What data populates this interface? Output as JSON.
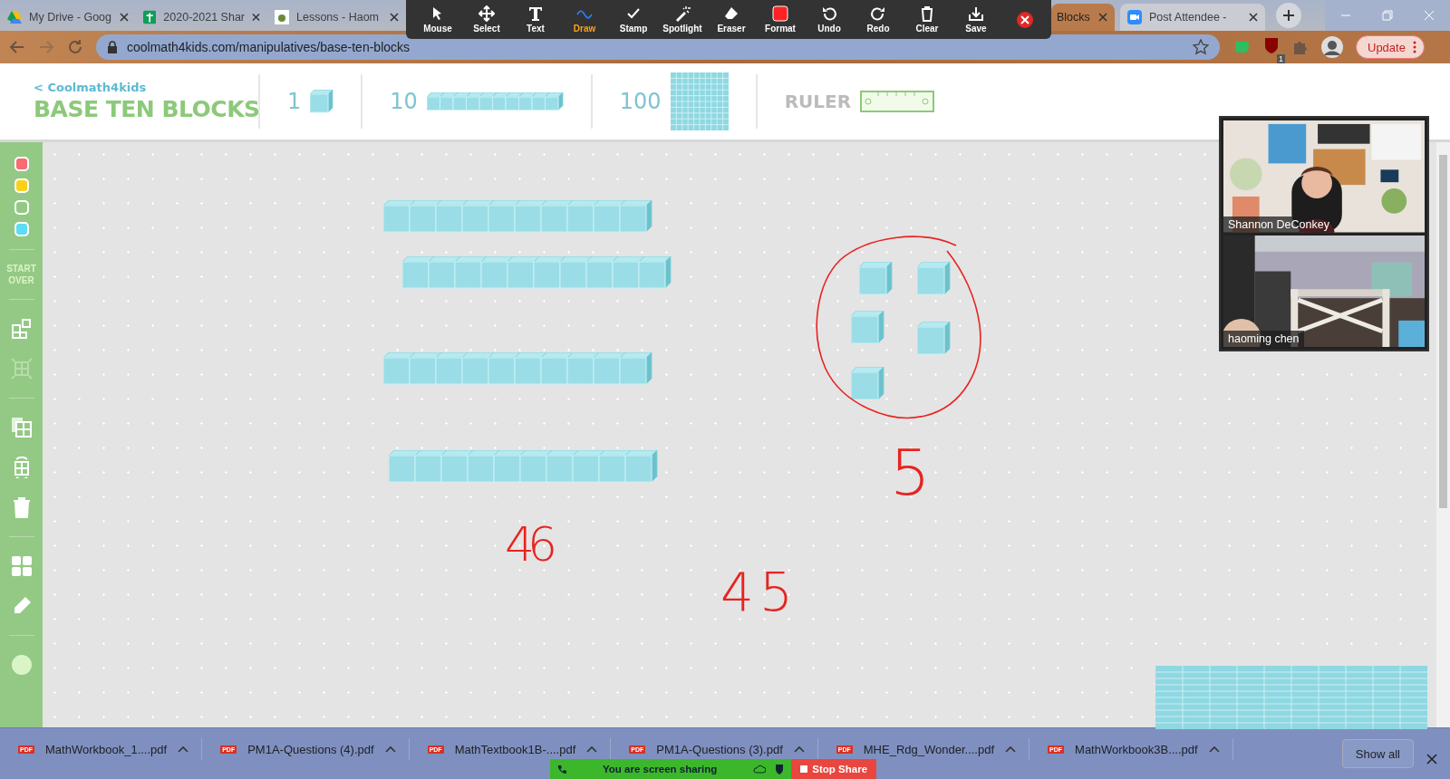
{
  "browser": {
    "tabs": [
      {
        "title": "My Drive - Goog",
        "kind": "drive",
        "selected": false
      },
      {
        "title": "2020-2021 Shar",
        "kind": "sheets",
        "selected": false
      },
      {
        "title": "Lessons - Haom",
        "kind": "doc",
        "selected": false
      },
      {
        "title": "Blocks",
        "kind": "page",
        "selected": true
      },
      {
        "title": "Post Attendee -",
        "kind": "zoom",
        "selected": false
      }
    ],
    "url": "coolmath4kids.com/manipulatives/base-ten-blocks",
    "extension_badge": "1",
    "update_button": "Update"
  },
  "annotation_toolbar": {
    "tools": [
      {
        "label": "Mouse",
        "selected": false
      },
      {
        "label": "Select",
        "selected": false
      },
      {
        "label": "Text",
        "selected": false
      },
      {
        "label": "Draw",
        "selected": true
      },
      {
        "label": "Stamp",
        "selected": false
      },
      {
        "label": "Spotlight",
        "selected": false
      },
      {
        "label": "Eraser",
        "selected": false
      },
      {
        "label": "Format",
        "selected": false
      },
      {
        "label": "Undo",
        "selected": false
      },
      {
        "label": "Redo",
        "selected": false
      },
      {
        "label": "Clear",
        "selected": false
      },
      {
        "label": "Save",
        "selected": false
      }
    ]
  },
  "app": {
    "back_mark": "<",
    "logo": "Coolmath4kids",
    "title": "BASE TEN BLOCKS",
    "blocks": [
      {
        "label": "1",
        "kind": "unit"
      },
      {
        "label": "10",
        "kind": "rod"
      },
      {
        "label": "100",
        "kind": "flat"
      },
      {
        "label": "RULER",
        "kind": "ruler"
      }
    ]
  },
  "sidebar": {
    "colors": [
      {
        "color": "#f86b72"
      },
      {
        "color": "#f9d11a"
      },
      {
        "color": "#93c985"
      },
      {
        "color": "#5ddcf5"
      }
    ],
    "start_over": "START OVER"
  },
  "canvas": {
    "handwriting": [
      "46",
      "5",
      "45"
    ]
  },
  "participants": [
    {
      "name": "Shannon DeConkey"
    },
    {
      "name": "haoming chen"
    }
  ],
  "downloads": {
    "files": [
      {
        "name": "MathWorkbook_1....pdf",
        "badge": "PDF"
      },
      {
        "name": "PM1A-Questions (4).pdf",
        "badge": "PDF"
      },
      {
        "name": "MathTextbook1B-....pdf",
        "badge": "PDF"
      },
      {
        "name": "PM1A-Questions (3).pdf",
        "badge": "PDF"
      },
      {
        "name": "MHE_Rdg_Wonder....pdf",
        "badge": "PDF"
      },
      {
        "name": "MathWorkbook3B....pdf",
        "badge": "PDF"
      }
    ],
    "show_all": "Show all"
  },
  "screen_share": {
    "status": "You are screen sharing",
    "stop": "Stop Share"
  }
}
